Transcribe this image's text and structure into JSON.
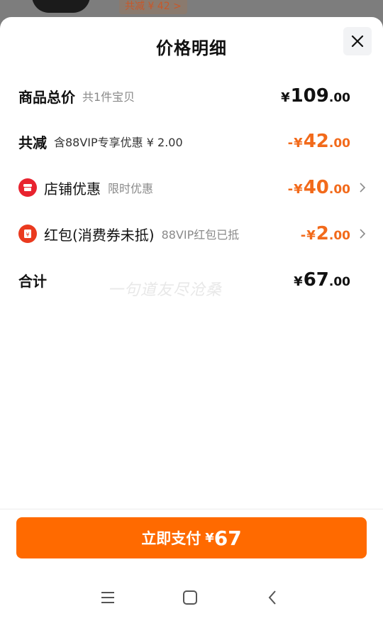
{
  "background": {
    "discount_label": "共减 ¥ 42 >"
  },
  "sheet": {
    "title": "价格明细"
  },
  "rows": [
    {
      "label": "商品总价",
      "sub": "共1件宝贝",
      "amount": {
        "prefix": "",
        "currency": "¥",
        "int": "109",
        "dec": ".00"
      }
    },
    {
      "label": "共减",
      "sub": "含88VIP专享优惠 ¥ 2.00",
      "amount": {
        "prefix": "-",
        "currency": "¥",
        "int": "42",
        "dec": ".00"
      }
    },
    {
      "label": "店铺优惠",
      "sub": "限时优惠",
      "amount": {
        "prefix": "-",
        "currency": "¥",
        "int": "40",
        "dec": ".00"
      }
    },
    {
      "label": "红包(消费券未抵)",
      "sub": "88VIP红包已抵",
      "amount": {
        "prefix": "-",
        "currency": "¥",
        "int": "2",
        "dec": ".00"
      }
    },
    {
      "label": "合计",
      "sub": "",
      "amount": {
        "prefix": "",
        "currency": "¥",
        "int": "67",
        "dec": ".00"
      }
    }
  ],
  "watermark": "一句道友尽沧桑",
  "pay_button": {
    "label": "立即支付",
    "currency": "¥",
    "amount": "67"
  },
  "colors": {
    "accent": "#ff6a00",
    "discount": "#f26a1b",
    "icon_red": "#e8232f"
  },
  "icons": {
    "close": "close-icon",
    "store": "store-icon",
    "red_packet": "red-packet-icon",
    "chevron": "chevron-right-icon"
  }
}
